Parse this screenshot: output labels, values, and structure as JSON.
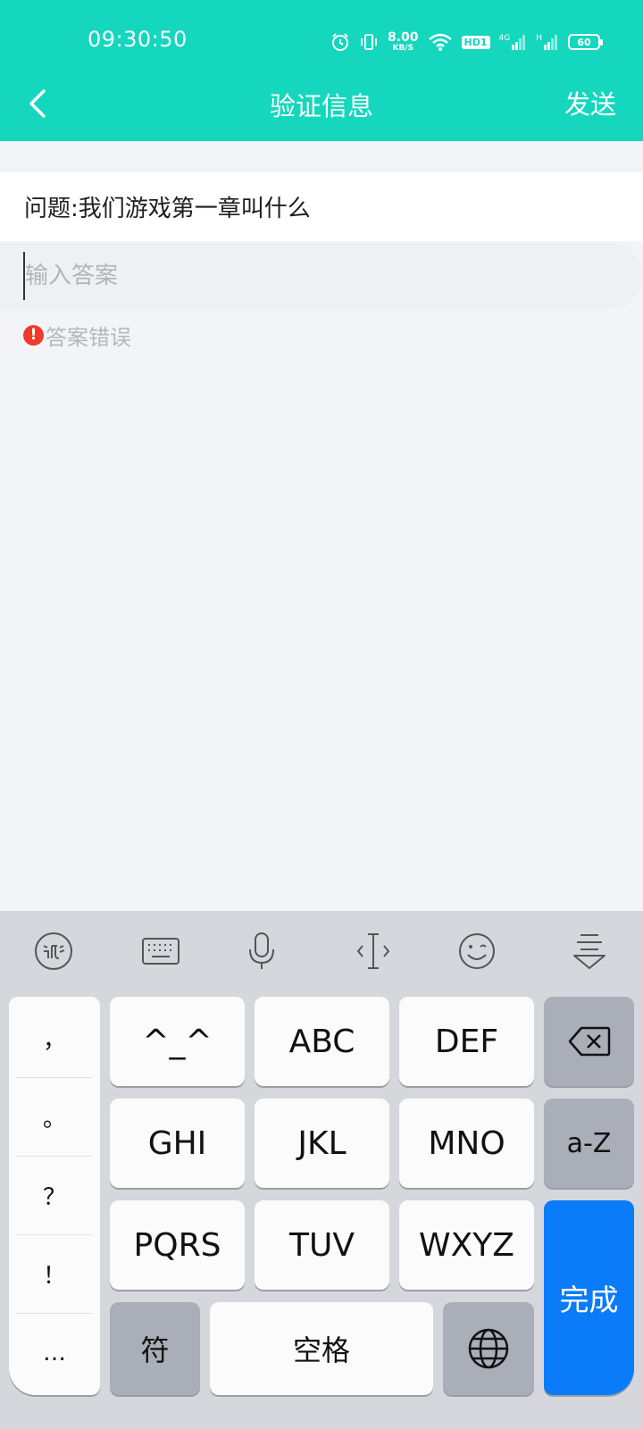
{
  "status_bar": {
    "time": "09:30:50",
    "net_speed_value": "8.00",
    "net_speed_unit": "KB/S",
    "hd_label": "HD1",
    "network_4g": "4G",
    "network_h": "H",
    "battery": "60"
  },
  "nav": {
    "title": "验证信息",
    "send_label": "发送"
  },
  "form": {
    "question": "问题:我们游戏第一章叫什么",
    "answer_placeholder": "输入答案",
    "answer_value": "",
    "error_icon": "!",
    "error_text": "答案错误"
  },
  "keyboard": {
    "toolbar_icons": [
      "xunfei-logo-icon",
      "keyboard-icon",
      "microphone-icon",
      "cursor-move-icon",
      "emoji-icon",
      "collapse-keyboard-icon"
    ],
    "punctuation": [
      "，",
      "。",
      "？",
      "！",
      "…"
    ],
    "keys": {
      "k1": "^_^",
      "k2": "ABC",
      "k3": "DEF",
      "k4": "GHI",
      "k5": "JKL",
      "k6": "MNO",
      "k7": "PQRS",
      "k8": "TUV",
      "k9": "WXYZ",
      "az": "a-Z",
      "symbols": "符",
      "space": "空格",
      "done": "完成"
    }
  },
  "colors": {
    "header": "#14d7bd",
    "error": "#f03a2c",
    "done_key": "#0a7cf9"
  }
}
